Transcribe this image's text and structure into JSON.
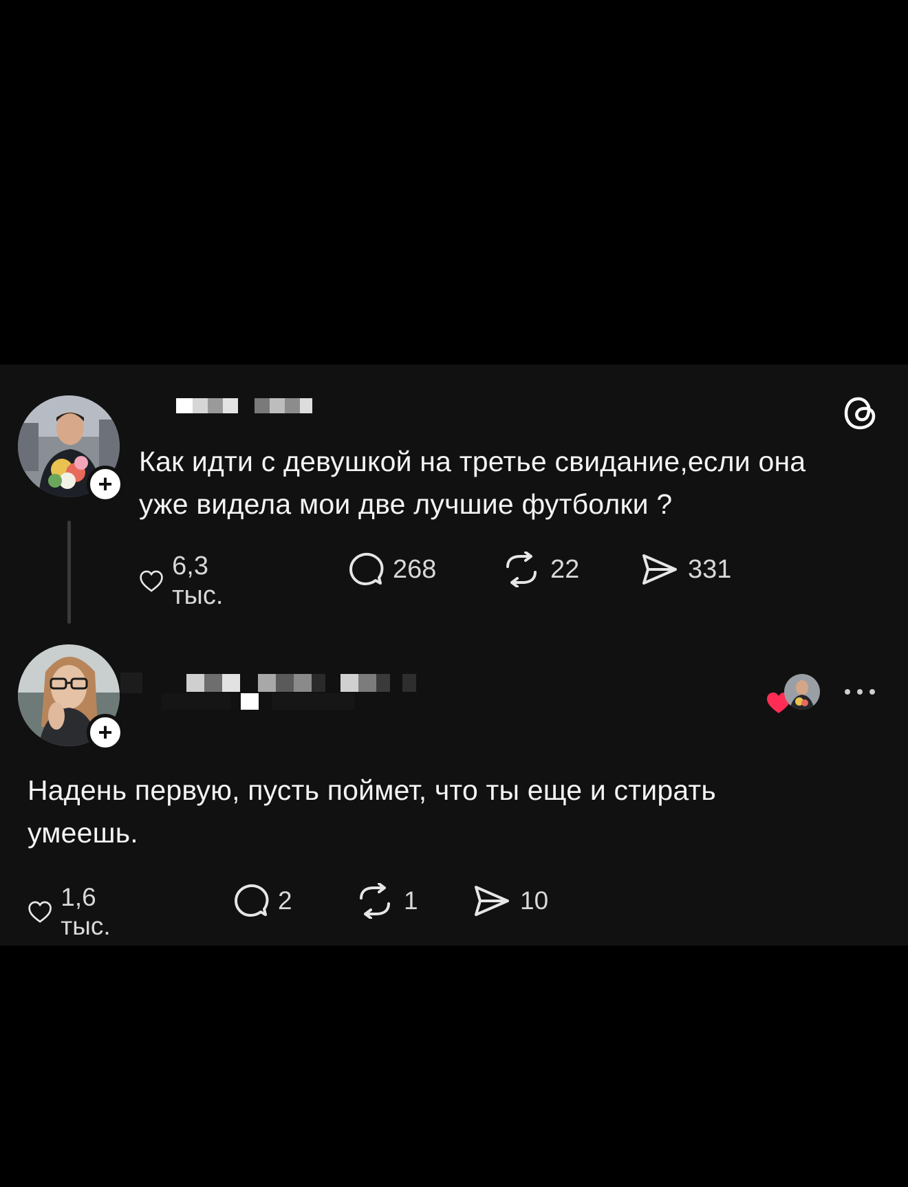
{
  "post": {
    "text_line1": "Как идти с девушкой на третье свидание,если она",
    "text_line2": "уже видела мои две лучшие футболки ?",
    "likes": "6,3 тыс.",
    "replies": "268",
    "reposts": "22",
    "shares": "331",
    "follow_symbol": "+"
  },
  "reply": {
    "text_line1": "Надень первую, пусть поймет, что ты еще и стирать",
    "text_line2": "умеешь.",
    "likes": "1,6 тыс.",
    "replies": "2",
    "reposts": "1",
    "shares": "10",
    "follow_symbol": "+"
  },
  "icons": {
    "app": "threads-logo-icon",
    "like": "heart-icon",
    "reply": "speech-bubble-icon",
    "repost": "repost-icon",
    "share": "send-icon",
    "more": "more-dots-icon"
  },
  "colors": {
    "background": "#000000",
    "card": "#111111",
    "text": "#f4f4f4",
    "secondary": "#d8d8d8",
    "heart_red": "#ff2d55"
  }
}
